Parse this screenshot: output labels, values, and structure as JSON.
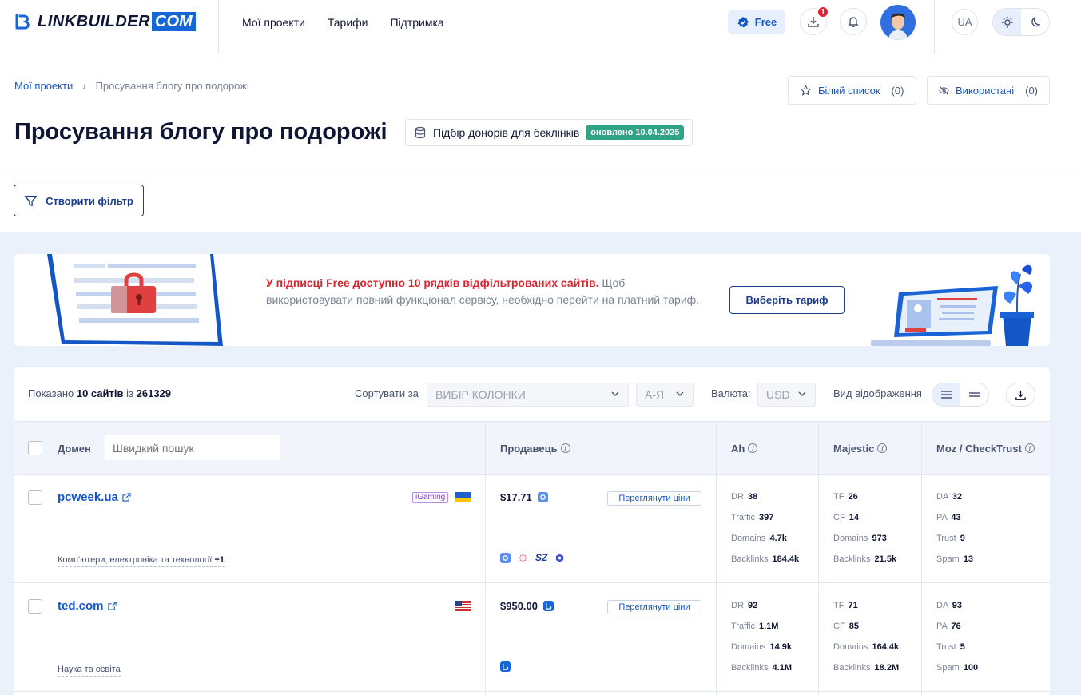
{
  "header": {
    "logo_text": "LINKBUILDER",
    "logo_com": "COM",
    "nav": [
      "Мої проекти",
      "Тарифи",
      "Підтримка"
    ],
    "plan_badge": "Free",
    "downloads_count": "1",
    "lang": "UA"
  },
  "breadcrumb": {
    "root": "Мої проекти",
    "current": "Просування блогу про подорожі"
  },
  "top_actions": {
    "whitelist_label": "Білий список",
    "whitelist_count": "(0)",
    "used_label": "Використані",
    "used_count": "(0)"
  },
  "page": {
    "title": "Просування блогу про подорожі",
    "donor_chip": "Підбір донорів для беклінків",
    "updated_badge": "оновлено 10.04.2025",
    "filter_button": "Створити фільтр"
  },
  "banner": {
    "highlight": "У підписці Free доступно 10 рядків відфільтрованих сайтів.",
    "text": " Щоб використовувати повний функціонал сервісу, необхідно перейти на платний тариф.",
    "button": "Виберіть тариф"
  },
  "toolbar": {
    "shown_prefix": "Показано",
    "shown_count": "10 сайтів",
    "shown_of": "із",
    "shown_total": "261329",
    "sort_label": "Сортувати за",
    "sort_column": "ВИБІР КОЛОНКИ",
    "sort_order": "А-Я",
    "currency_label": "Валюта:",
    "currency": "USD",
    "view_label": "Вид відображення"
  },
  "table": {
    "headers": {
      "domain": "Домен",
      "search_placeholder": "Швидкий пошук",
      "seller": "Продавець",
      "ah": "Ah",
      "majestic": "Majestic",
      "moz": "Moz / CheckTrust"
    },
    "view_prices": "Переглянути ціни",
    "rows": [
      {
        "domain": "pcweek.ua",
        "tag": "iGaming",
        "category": "Комп'ютери, електроніка та технології",
        "category_extra": "+1",
        "price": "$17.71",
        "ah": {
          "DR": "38",
          "Traffic": "397",
          "Domains": "4.7k",
          "Backlinks": "184.4k"
        },
        "majestic": {
          "TF": "26",
          "CF": "14",
          "Domains": "973",
          "Backlinks": "21.5k"
        },
        "moz": {
          "DA": "32",
          "PA": "43",
          "Trust": "9",
          "Spam": "13"
        }
      },
      {
        "domain": "ted.com",
        "tag": "",
        "category": "Наука та освіта",
        "category_extra": "",
        "price": "$950.00",
        "ah": {
          "DR": "92",
          "Traffic": "1.1M",
          "Domains": "14.9k",
          "Backlinks": "4.1M"
        },
        "majestic": {
          "TF": "71",
          "CF": "85",
          "Domains": "164.4k",
          "Backlinks": "18.2M"
        },
        "moz": {
          "DA": "93",
          "PA": "76",
          "Trust": "5",
          "Spam": "100"
        }
      }
    ],
    "metric_labels": {
      "ah": [
        "DR",
        "Traffic",
        "Domains",
        "Backlinks"
      ],
      "majestic": [
        "TF",
        "CF",
        "Domains",
        "Backlinks"
      ],
      "moz": [
        "DA",
        "PA",
        "Trust",
        "Spam"
      ]
    }
  },
  "colors": {
    "primary": "#1556c6",
    "navy": "#1d3f8a",
    "alert_red": "#d8262e",
    "updated_green": "#2fa386",
    "content_bg": "#eaf1fa"
  }
}
